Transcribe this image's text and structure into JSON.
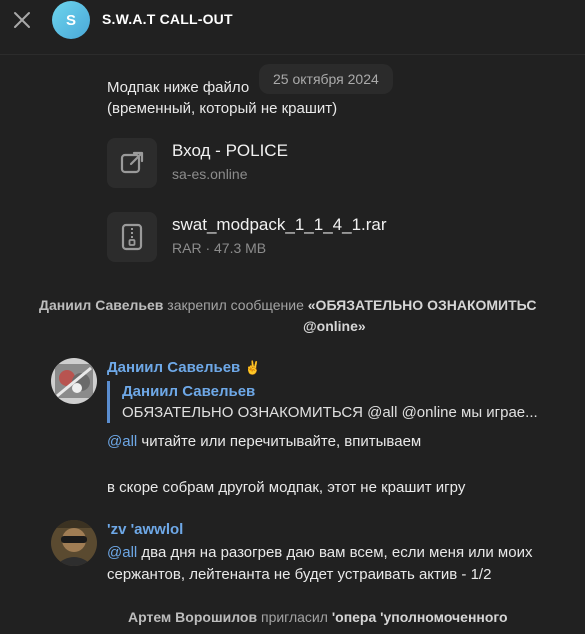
{
  "header": {
    "close_icon": "close-icon",
    "avatar_letter": "S",
    "title": "S.W.A.T CALL-OUT"
  },
  "date_separator": "25 октября 2024",
  "message1": {
    "line1": "Модпак ниже файло",
    "line2": "(временный, который не крашит)"
  },
  "files": [
    {
      "icon": "external-link-icon",
      "name": "Вход - POLICE",
      "sub": "sa-es.online"
    },
    {
      "icon": "archive-icon",
      "name": "swat_modpack_1_1_4_1.rar",
      "sub": "RAR · 47.3 MB"
    }
  ],
  "pinned_service": {
    "actor": "Даниил Савельев",
    "action": " закрепил сообщение ",
    "quote": "«ОБЯЗАТЕЛЬНО ОЗНАКОМИТЬС",
    "line2": "@online»"
  },
  "message2": {
    "sender": "Даниил Савельев",
    "reply_name": "Даниил Савельев",
    "reply_text": "ОБЯЗАТЕЛЬНО ОЗНАКОМИТЬСЯ @all @online мы играе...",
    "mention": "@all",
    "text1": " читайте или перечитывайте, впитываем",
    "text2": "в скоре собрам другой модпак, этот не крашит игру"
  },
  "message3": {
    "sender": "'zv 'awwlol",
    "mention": "@all",
    "text1": " два дня на разогрев даю вам всем, если меня или моих",
    "text2": "сержантов, лейтенанта не будет устраивать актив - 1/2"
  },
  "invite_service": {
    "actor": "Артем Ворошилов",
    "action": " пригласил ",
    "target": "'опера 'уполномоченного"
  },
  "colors": {
    "background": "#212121",
    "accent": "#6ea8e7",
    "avatar": "#4aa8d8"
  }
}
